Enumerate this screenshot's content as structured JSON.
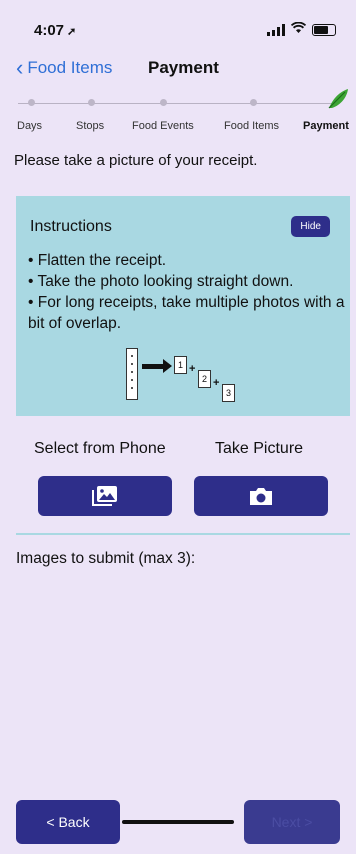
{
  "status": {
    "time": "4:07"
  },
  "nav": {
    "back_label": "Food Items",
    "title": "Payment"
  },
  "stepper": {
    "steps": [
      "Days",
      "Stops",
      "Food Events",
      "Food Items",
      "Payment"
    ],
    "active_index": 4
  },
  "prompt": "Please take a picture of your receipt.",
  "instructions": {
    "title": "Instructions",
    "hide_label": "Hide",
    "items": [
      "• Flatten the receipt.",
      "• Take the photo looking straight down.",
      "• For long receipts, take multiple photos with a bit of overlap."
    ],
    "diagram_pieces": [
      "1",
      "2",
      "3"
    ],
    "diagram_plus": "+"
  },
  "actions": {
    "select_label": "Select from Phone",
    "take_label": "Take Picture",
    "select_icon": "gallery-icon",
    "take_icon": "camera-icon"
  },
  "submit": {
    "label": "Images to submit (max 3):"
  },
  "footer": {
    "back_label": "< Back",
    "next_label": "Next >"
  },
  "colors": {
    "background": "#ece4f7",
    "accent": "#2e2e8a",
    "instructions_bg": "#a9d8e2",
    "link": "#2f6fd6"
  }
}
